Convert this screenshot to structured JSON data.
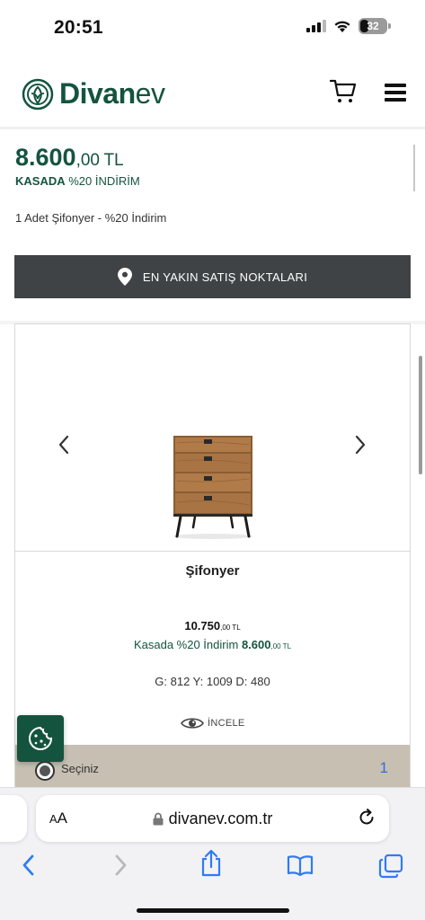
{
  "status_bar": {
    "time": "20:51",
    "battery": "32"
  },
  "header": {
    "logo_bold": "Divan",
    "logo_light": "ev"
  },
  "price": {
    "integer": "8.600",
    "decimal": ",00",
    "currency": "TL",
    "kasada_label": "KASADA",
    "kasada_rest": "%20 İNDİRİM"
  },
  "set_description": "1 Adet Şifonyer - %20 İndirim",
  "stores_button": "EN YAKIN SATIŞ NOKTALARI",
  "product": {
    "title": "Şifonyer",
    "old_price_int": "10.750",
    "old_price_dec": ",00 TL",
    "kasada_text": "Kasada %20 İndirim",
    "kasada_price_int": "8.600",
    "kasada_price_dec": ",00 TL",
    "dimensions": "G: 812 Y: 1009 D: 480",
    "incele": "İNCELE",
    "select_label": "Seçiniz",
    "quantity": "1"
  },
  "safari": {
    "aa_small": "A",
    "aa_big": "A",
    "url": "divanev.com.tr"
  },
  "colors": {
    "brand_green": "#14543f",
    "button_dark": "#3f4346",
    "select_bar": "#c8bfb3",
    "ios_blue": "#2f7bf5"
  },
  "icons": [
    "signal-icon",
    "wifi-icon",
    "battery-icon",
    "logo-icon",
    "cart-icon",
    "menu-icon",
    "location-pin-icon",
    "chevron-left-icon",
    "chevron-right-icon",
    "eye-icon",
    "cookie-icon",
    "lock-icon",
    "reload-icon",
    "back-icon",
    "forward-icon",
    "share-icon",
    "bookmarks-icon",
    "tabs-icon"
  ]
}
